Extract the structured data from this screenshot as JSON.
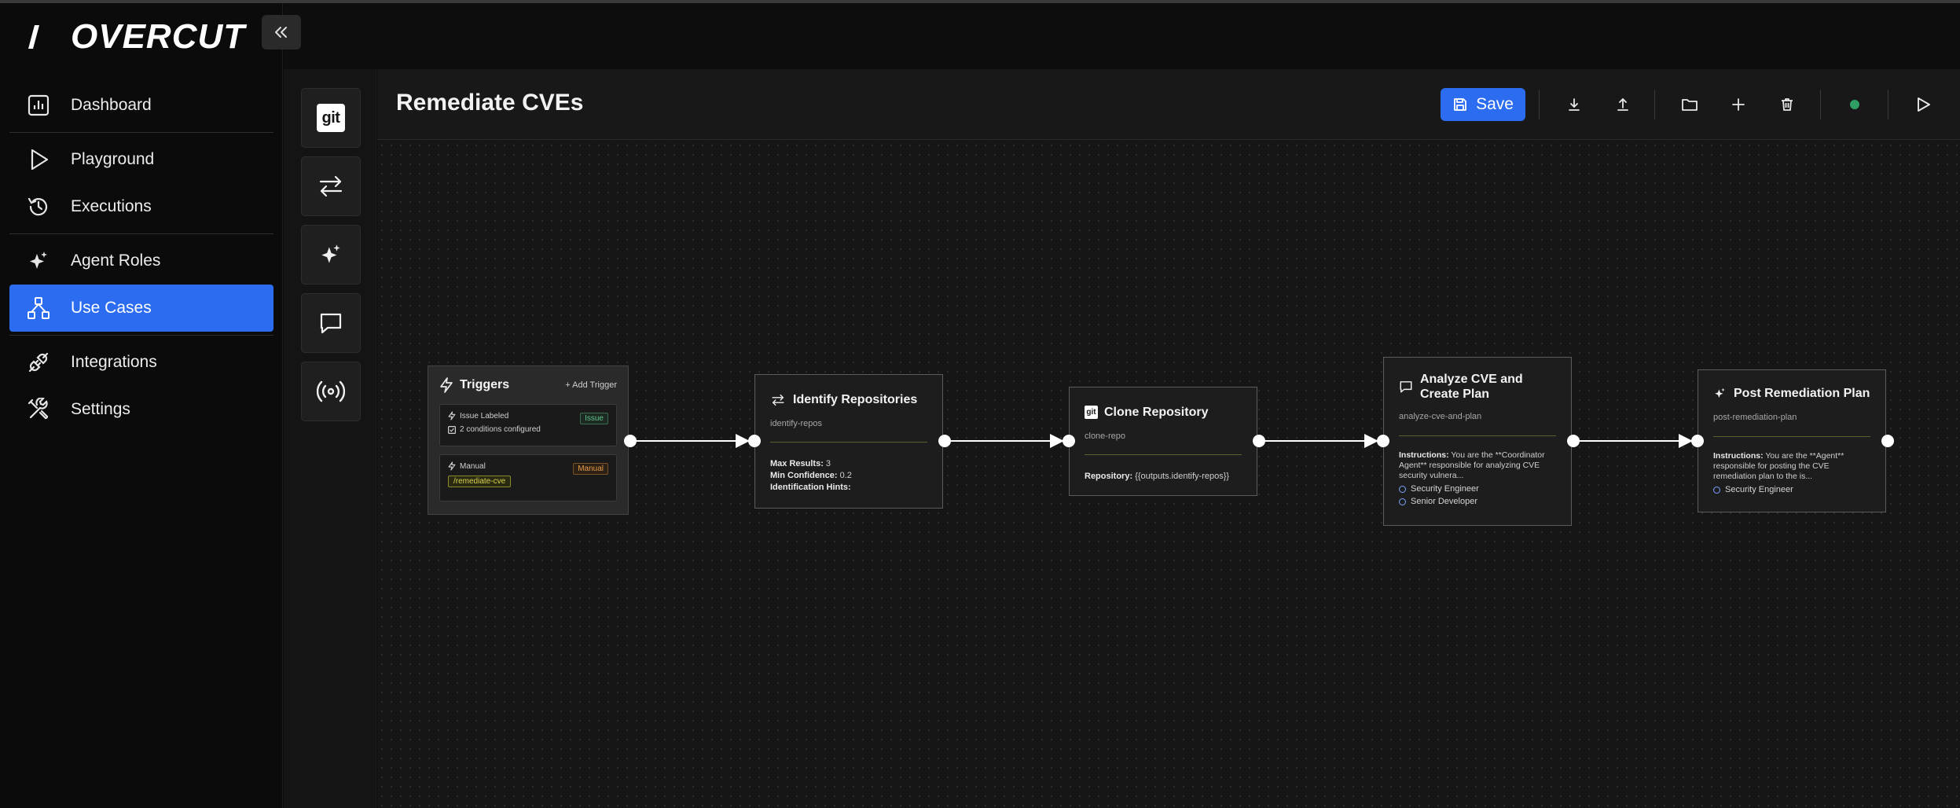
{
  "brand": {
    "name": "OVERCUT"
  },
  "sidebar": {
    "items": [
      {
        "label": "Dashboard",
        "icon": "chart-icon"
      },
      {
        "label": "Playground",
        "icon": "play-icon"
      },
      {
        "label": "Executions",
        "icon": "history-icon"
      },
      {
        "label": "Agent Roles",
        "icon": "sparkle-icon"
      },
      {
        "label": "Use Cases",
        "icon": "network-icon",
        "active": true
      },
      {
        "label": "Integrations",
        "icon": "plug-icon"
      },
      {
        "label": "Settings",
        "icon": "tools-icon"
      }
    ]
  },
  "palette": {
    "git_label": "git",
    "tools": [
      "git-icon",
      "arrows-swap-icon",
      "sparkle-icon",
      "chat-icon",
      "broadcast-icon"
    ]
  },
  "workspace": {
    "title": "Remediate CVEs",
    "save_label": "Save",
    "accent": "#2b6cf0",
    "status_color": "#2e9e62"
  },
  "flow": {
    "triggers": {
      "title": "Triggers",
      "add_label": "+ Add Trigger",
      "items": [
        {
          "name": "Issue Labeled",
          "badge": "Issue",
          "detail": "2 conditions configured"
        },
        {
          "name": "Manual",
          "badge": "Manual",
          "command": "/remediate-cve"
        }
      ]
    },
    "nodes": [
      {
        "title": "Identify Repositories",
        "key": "identify-repos",
        "fields": [
          {
            "label": "Max Results:",
            "value": "3"
          },
          {
            "label": "Min Confidence:",
            "value": "0.2"
          },
          {
            "label": "Identification Hints:",
            "value": ""
          }
        ]
      },
      {
        "title": "Clone Repository",
        "key": "clone-repo",
        "fields": [
          {
            "label": "Repository:",
            "value": "{{outputs.identify-repos}}"
          }
        ]
      },
      {
        "title_line1": "Analyze CVE and",
        "title_line2": "Create Plan",
        "key": "analyze-cve-and-plan",
        "instructions_label": "Instructions:",
        "instructions_l1": "You are the **Coordinator",
        "instructions_l2": "Agent** responsible for analyzing CVE",
        "instructions_l3": "security vulnera...",
        "roles": [
          "Security Engineer",
          "Senior Developer"
        ]
      },
      {
        "title": "Post Remediation Plan",
        "key": "post-remediation-plan",
        "instructions_label": "Instructions:",
        "instructions_l1": "You are the **Agent**",
        "instructions_l2": "responsible for posting the CVE",
        "instructions_l3": "remediation plan to the is...",
        "roles": [
          "Security Engineer"
        ]
      }
    ]
  }
}
